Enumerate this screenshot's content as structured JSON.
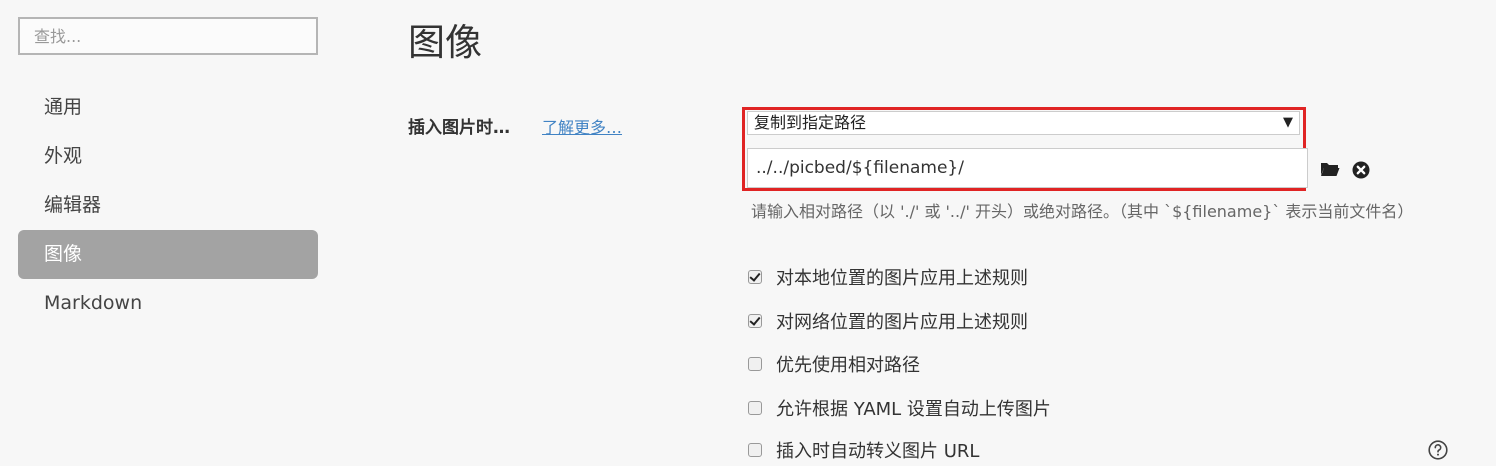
{
  "sidebar": {
    "search_placeholder": "查找...",
    "items": [
      {
        "label": "通用"
      },
      {
        "label": "外观"
      },
      {
        "label": "编辑器"
      },
      {
        "label": "图像"
      },
      {
        "label": "Markdown"
      }
    ],
    "active_index": 3
  },
  "main": {
    "title": "图像",
    "insert_label": "插入图片时…",
    "learn_more": "了解更多…",
    "select_value": "复制到指定路径",
    "path_value": "../../picbed/${filename}/",
    "help_text": "请输入相对路径（以 './' 或 '../' 开头）或绝对路径。（其中 `${filename}` 表示当前文件名）",
    "options": [
      {
        "label": "对本地位置的图片应用上述规则",
        "checked": true
      },
      {
        "label": "对网络位置的图片应用上述规则",
        "checked": true
      },
      {
        "label": "优先使用相对路径",
        "checked": false
      },
      {
        "label": "允许根据 YAML 设置自动上传图片",
        "checked": false
      },
      {
        "label": "插入时自动转义图片 URL",
        "checked": false
      }
    ]
  },
  "icons": {
    "folder": "folder-icon",
    "clear": "clear-icon",
    "help": "help-icon",
    "dropdown": "caret-down-icon"
  },
  "colors": {
    "highlight": "#e02424",
    "link": "#4183c4",
    "active_nav": "#a3a3a3"
  }
}
